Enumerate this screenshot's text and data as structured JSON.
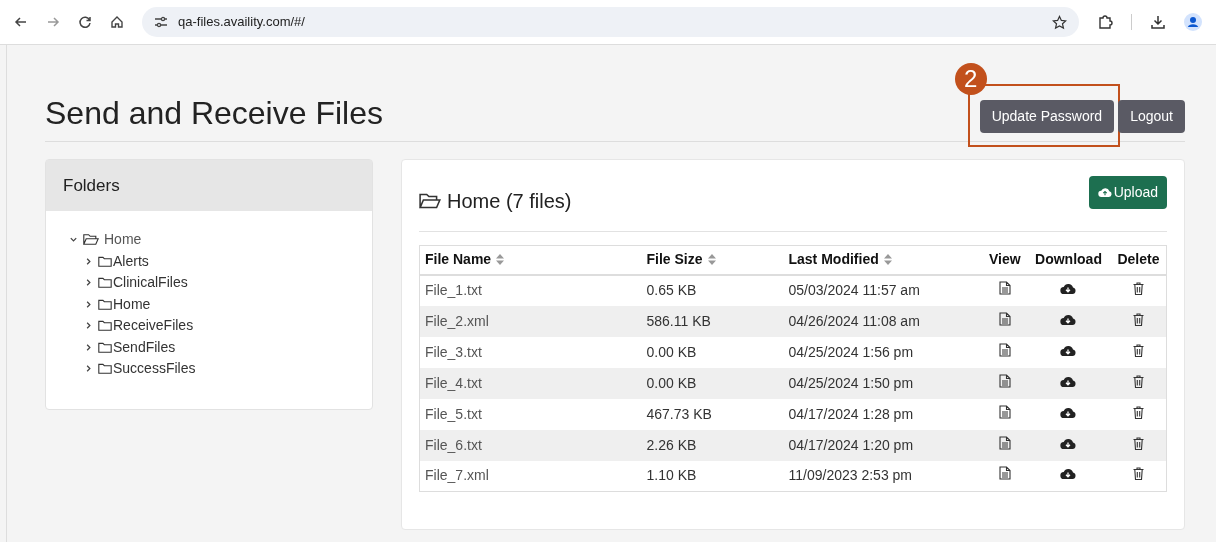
{
  "browser": {
    "url": "qa-files.availity.com/#/"
  },
  "page": {
    "title": "Send and Receive Files",
    "buttons": [
      {
        "label": "Update Password",
        "highlighted": true
      },
      {
        "label": "Logout",
        "highlighted": false
      }
    ],
    "annotation": "2"
  },
  "folders": {
    "title": "Folders",
    "tree": [
      {
        "label": "Home",
        "expanded": true,
        "children": [
          {
            "label": "Alerts",
            "expanded": false
          },
          {
            "label": "ClinicalFiles",
            "expanded": false
          },
          {
            "label": "Home",
            "expanded": false
          },
          {
            "label": "ReceiveFiles",
            "expanded": false
          },
          {
            "label": "SendFiles",
            "expanded": false
          },
          {
            "label": "SuccessFiles",
            "expanded": false
          }
        ]
      }
    ]
  },
  "files": {
    "title": "Home (7 files)",
    "upload": "Upload",
    "columns": [
      {
        "label": "File Name",
        "sortable": true
      },
      {
        "label": "File Size",
        "sortable": true
      },
      {
        "label": "Last Modified",
        "sortable": true
      },
      {
        "label": "View",
        "sortable": false
      },
      {
        "label": "Download",
        "sortable": false
      },
      {
        "label": "Delete",
        "sortable": false
      }
    ],
    "rows": [
      {
        "name": "File_1.txt",
        "size": "0.65 KB",
        "modified": "05/03/2024 11:57 am"
      },
      {
        "name": "File_2.xml",
        "size": "586.11 KB",
        "modified": "04/26/2024 11:08 am"
      },
      {
        "name": "File_3.txt",
        "size": "0.00 KB",
        "modified": "04/25/2024 1:56 pm"
      },
      {
        "name": "File_4.txt",
        "size": "0.00 KB",
        "modified": "04/25/2024 1:50 pm"
      },
      {
        "name": "File_5.txt",
        "size": "467.73 KB",
        "modified": "04/17/2024 1:28 pm"
      },
      {
        "name": "File_6.txt",
        "size": "2.26 KB",
        "modified": "04/17/2024 1:20 pm"
      },
      {
        "name": "File_7.xml",
        "size": "1.10 KB",
        "modified": "11/09/2023 2:53 pm"
      }
    ]
  }
}
